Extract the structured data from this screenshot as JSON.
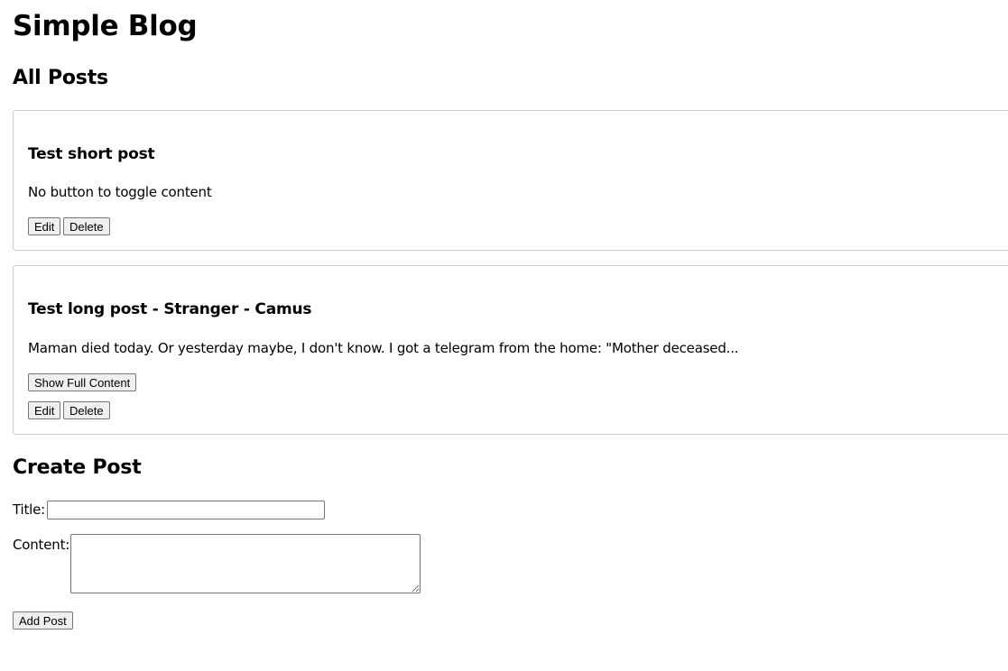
{
  "site": {
    "title": "Simple Blog"
  },
  "posts_section": {
    "heading": "All Posts",
    "posts": [
      {
        "title": "Test short post",
        "content": "No button to toggle content",
        "edit_label": "Edit",
        "delete_label": "Delete"
      },
      {
        "title": "Test long post - Stranger - Camus",
        "content": "Maman died today. Or yesterday maybe, I don't know. I got a telegram from the home: \"Mother deceased...",
        "toggle_label": "Show Full Content",
        "edit_label": "Edit",
        "delete_label": "Delete"
      }
    ]
  },
  "create_section": {
    "heading": "Create Post",
    "title_label": "Title:",
    "title_value": "",
    "content_label": "Content:",
    "content_value": "",
    "submit_label": "Add Post"
  }
}
